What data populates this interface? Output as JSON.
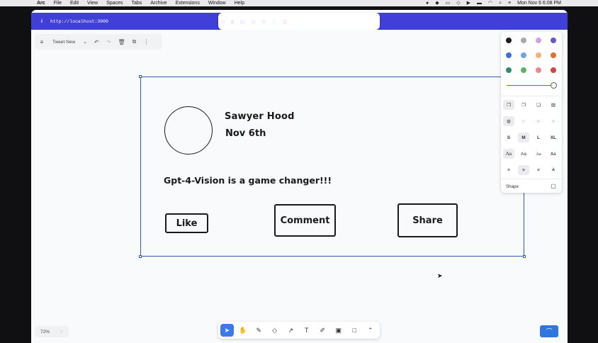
{
  "menubar": {
    "app": "Arc",
    "items": [
      "File",
      "Edit",
      "View",
      "Spaces",
      "Tabs",
      "Archive",
      "Extensions",
      "Window",
      "Help"
    ],
    "datetime": "Mon Nov 6  6:08 PM"
  },
  "browser": {
    "url": "http://localhost:3000",
    "accent": "#4040d8"
  },
  "toolbar": {
    "page_name": "Tweet New"
  },
  "drawing": {
    "name": "Sawyer Hood",
    "date": "Nov 6th",
    "post": "Gpt-4-Vision is a game changer!!!",
    "buttons": {
      "like": "Like",
      "comment": "Comment",
      "share": "Share"
    }
  },
  "style_panel": {
    "colors": [
      "#1d1d1d",
      "#a8a8a8",
      "#d6a0e6",
      "#6b57c7",
      "#3f6fd1",
      "#6fa2e8",
      "#f0b47a",
      "#e06f2f",
      "#2e8d6a",
      "#5bb36a",
      "#e8898b",
      "#d0473f"
    ],
    "sizes": [
      "S",
      "M",
      "L",
      "XL"
    ],
    "font_label": "Aa",
    "shape_label": "Shape"
  },
  "zoom": {
    "level": "72%"
  }
}
